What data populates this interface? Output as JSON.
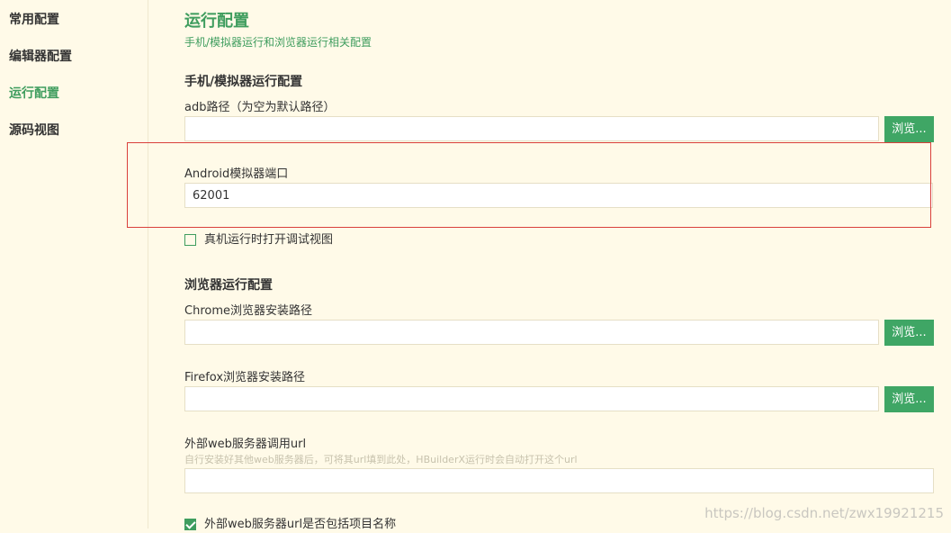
{
  "sidebar": {
    "items": [
      {
        "label": "常用配置"
      },
      {
        "label": "编辑器配置"
      },
      {
        "label": "运行配置"
      },
      {
        "label": "源码视图"
      }
    ],
    "active_index": 2
  },
  "page": {
    "title": "运行配置",
    "subtitle": "手机/模拟器运行和浏览器运行相关配置"
  },
  "mobile_section": {
    "title": "手机/模拟器运行配置",
    "adb_label": "adb路径（为空为默认路径）",
    "adb_value": "",
    "browse_label": "浏览...",
    "android_port_label": "Android模拟器端口",
    "android_port_value": "62001",
    "debug_view_label": "真机运行时打开调试视图",
    "debug_view_checked": false
  },
  "browser_section": {
    "title": "浏览器运行配置",
    "chrome_label": "Chrome浏览器安装路径",
    "chrome_value": "",
    "firefox_label": "Firefox浏览器安装路径",
    "firefox_value": "",
    "browse_label": "浏览...",
    "web_server_label": "外部web服务器调用url",
    "web_server_hint": "自行安装好其他web服务器后，可将其url填到此处，HBuilderX运行时会自动打开这个url",
    "web_server_value": "",
    "include_project_label": "外部web服务器url是否包括项目名称",
    "include_project_checked": true
  },
  "watermark": "https://blog.csdn.net/zwx19921215",
  "colors": {
    "background": "#fffae8",
    "accent": "#3f9d5e",
    "button": "#3fa665",
    "highlight": "#d9403b"
  }
}
